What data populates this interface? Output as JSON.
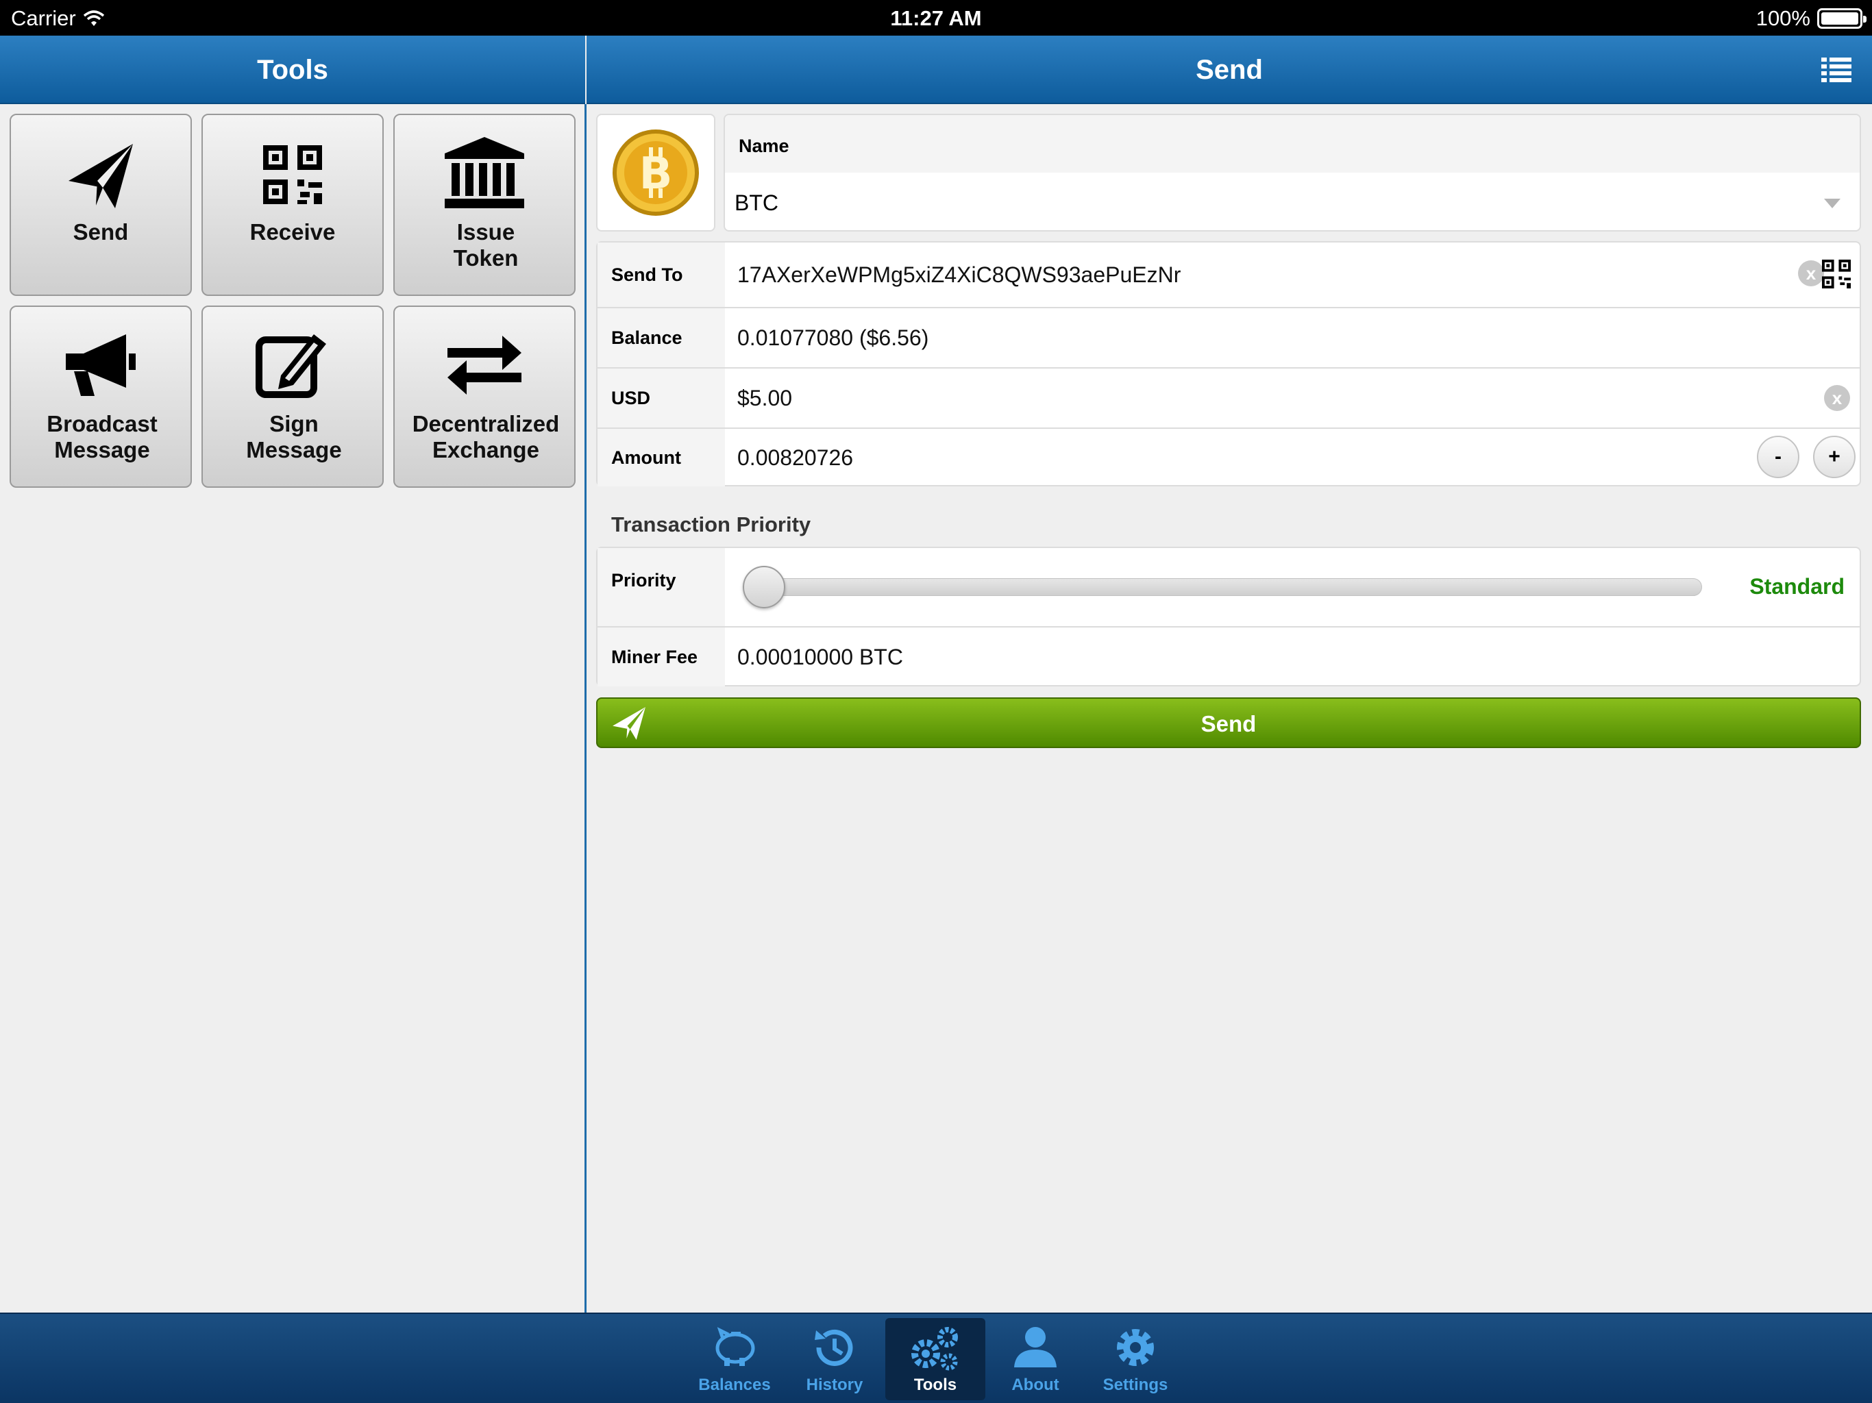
{
  "status_bar": {
    "carrier": "Carrier",
    "time": "11:27 AM",
    "battery": "100%"
  },
  "left_panel": {
    "title": "Tools",
    "tools": [
      {
        "label": "Send",
        "icon": "paper-plane-icon"
      },
      {
        "label": "Receive",
        "icon": "qr-code-icon"
      },
      {
        "label": "Issue Token",
        "icon": "bank-icon"
      },
      {
        "label": "Broadcast Message",
        "icon": "megaphone-icon"
      },
      {
        "label": "Sign Message",
        "icon": "pencil-square-icon"
      },
      {
        "label": "Decentralized Exchange",
        "icon": "exchange-arrows-icon"
      }
    ]
  },
  "right_panel": {
    "title": "Send",
    "asset": {
      "name_label": "Name",
      "name_value": "BTC"
    },
    "fields": {
      "send_to_label": "Send To",
      "send_to_value": "17AXerXeWPMg5xiZ4XiC8QWS93aePuEzNr",
      "balance_label": "Balance",
      "balance_value": "0.01077080 ($6.56)",
      "usd_label": "USD",
      "usd_value": "$5.00",
      "amount_label": "Amount",
      "amount_value": "0.00820726",
      "minus_label": "-",
      "plus_label": "+"
    },
    "priority": {
      "section_title": "Transaction Priority",
      "priority_label": "Priority",
      "priority_value": "Standard",
      "slider_position": 0,
      "miner_fee_label": "Miner Fee",
      "miner_fee_value": "0.00010000 BTC"
    },
    "send_button": "Send"
  },
  "tab_bar": {
    "tabs": [
      {
        "label": "Balances",
        "icon": "piggy-bank-icon"
      },
      {
        "label": "History",
        "icon": "history-icon"
      },
      {
        "label": "Tools",
        "icon": "gears-icon"
      },
      {
        "label": "About",
        "icon": "person-icon"
      },
      {
        "label": "Settings",
        "icon": "gear-icon"
      }
    ],
    "active": "Tools"
  },
  "colors": {
    "nav_blue": "#1a6aad",
    "send_green": "#5e9a08",
    "priority_green": "#1d8a0c",
    "tab_blue": "#4aa3e8"
  }
}
